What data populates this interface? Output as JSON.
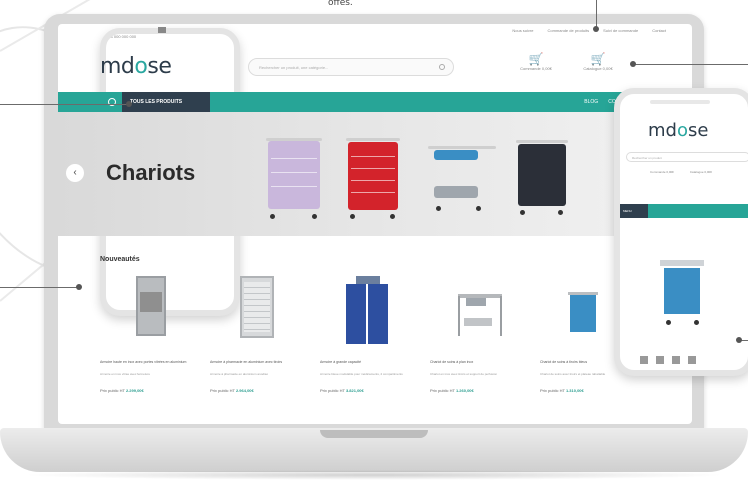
{
  "caption": "offes.",
  "site": {
    "topbar": {
      "phone": "+33 000 000 000",
      "links": [
        "Nous suivre",
        "Commande de produits",
        "Suivi de commande",
        "Contact"
      ]
    },
    "logo": {
      "part1": "md",
      "part2": "o",
      "part3": "se"
    },
    "search_placeholder": "Rechercher un produit, une catégorie...",
    "header_icons": [
      {
        "icon": "cart-icon",
        "label": "Commande 0,00€"
      },
      {
        "icon": "cart-icon",
        "label": "Catalogue 0,00€"
      }
    ],
    "nav": {
      "all_products": "TOUS LES PRODUITS",
      "links": [
        "BLOG",
        "CONTACT"
      ]
    },
    "hero": {
      "title": "Chariots",
      "arrow": "‹"
    },
    "section_title": "Nouveautés",
    "products": [
      {
        "name": "Armoire haute en inox avec portes vitrées en aluminium",
        "desc": "Armoire en inox vitrée avec fermeture",
        "price_label": "Prix public HT",
        "price": "2.299,00€"
      },
      {
        "name": "Armoire à pharmacie en aluminium avec tiroirs",
        "desc": "Armoire à pharmacie en aluminium anodisé",
        "price_label": "Prix public HT",
        "price": "2.964,00€"
      },
      {
        "name": "Armoire à grande capacité",
        "desc": "Armoire bleue modulable pour médicaments, 2 compartiments",
        "price_label": "Prix public HT",
        "price": "3.821,00€"
      },
      {
        "name": "Chariot de soins à plan inox",
        "desc": "Chariot en inox avec tiroirs et support de perfusion",
        "price_label": "Prix public HT",
        "price": "1.260,00€"
      },
      {
        "name": "Chariot de soins à tiroirs bleus",
        "desc": "Chariot de soins avec tiroirs et plateau rabattable",
        "price_label": "Prix public HT",
        "price": "1.310,00€"
      }
    ]
  },
  "phone": {
    "logo": {
      "part1": "md",
      "part2": "o",
      "part3": "se"
    },
    "search_placeholder": "Rechercher un produit",
    "icons": [
      "Commande 0,00€",
      "Catalogue 0,00€"
    ],
    "nav_button": "MENU"
  },
  "colors": {
    "accent": "#27a597",
    "dark": "#2f3f4e",
    "cart_lilac": "#c9b7dc",
    "cart_red": "#d3232b",
    "cart_blue": "#3a8ec4",
    "cart_black": "#2b2f38"
  }
}
